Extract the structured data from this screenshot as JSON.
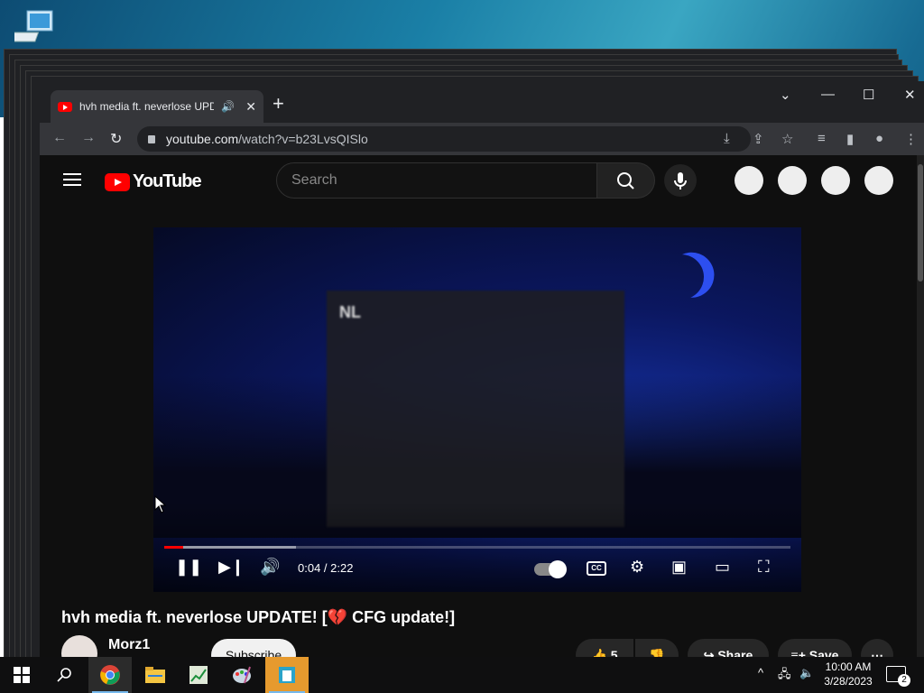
{
  "browser": {
    "tab_title": "hvh media ft. neverlose UPDATE! [",
    "new_tab_label": "+",
    "url_host": "youtube.com",
    "url_path": "/watch?v=b23LvsQISlo"
  },
  "youtube": {
    "logo_text": "YouTube",
    "search_placeholder": "Search",
    "video": {
      "panel_logo": "NL",
      "time_display": "0:04 / 2:22",
      "progress_fraction": 0.03,
      "buffered_fraction": 0.21
    },
    "title_pre": "hvh media ft. neverlose UPDATE! [",
    "title_heart": "💔",
    "title_post": " CFG update!]",
    "channel_name": "Morz1",
    "subscribe_label": "Subscribe",
    "like_count": "5",
    "share_label": "Share",
    "save_label": "Save"
  },
  "taskbar": {
    "time": "10:00 AM",
    "date": "3/28/2023",
    "notification_count": "2"
  },
  "colors": {
    "accent_red": "#ff0000",
    "taskbar_active": "#76b9ed"
  }
}
